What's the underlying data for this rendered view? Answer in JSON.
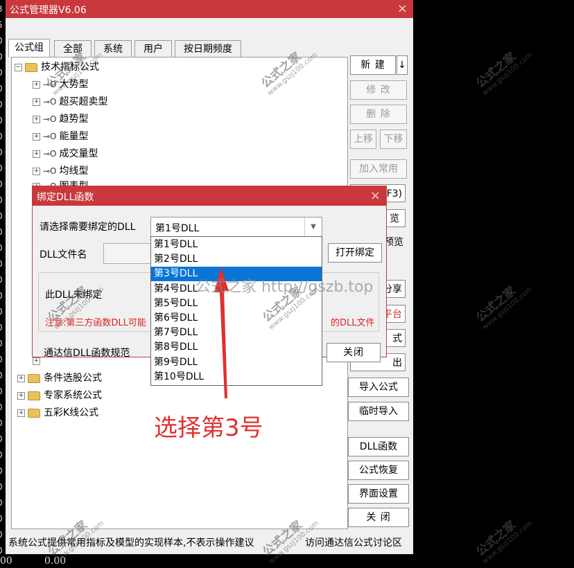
{
  "strip_numbers": [
    "3",
    "5",
    "0",
    "0",
    "0",
    "0",
    "0",
    "0",
    "0",
    "0",
    "0",
    "0",
    "0",
    "0",
    "0",
    "0",
    "0",
    "0",
    "0",
    "0",
    "0",
    "0",
    "0",
    "0",
    "0",
    "0",
    "0",
    "0",
    "0",
    "0",
    "0",
    "0",
    "0",
    "0",
    "0"
  ],
  "bottom_numbers": [
    "00",
    "0.00"
  ],
  "window": {
    "title": "公式管理器V6.06",
    "close": "×",
    "tabs": [
      "公式组",
      "全部",
      "系统",
      "用户",
      "按日期频度"
    ],
    "tree": {
      "root": "技术指标公式",
      "children": [
        "大势型",
        "超买超卖型",
        "趋势型",
        "能量型",
        "成交量型",
        "均线型",
        "图表型"
      ],
      "others": [
        "条件选股公式",
        "专家系统公式",
        "五彩K线公式"
      ]
    },
    "buttons": {
      "new": "新 建",
      "new_arrow": "↓",
      "modify": "修 改",
      "delete": "删 除",
      "up": "上移",
      "down": "下移",
      "add_common": "加入常用",
      "f3": "F3)",
      "browse": "览",
      "preview": "预览",
      "share": "分享",
      "platform": "平台",
      "formula": "式",
      "export": "出",
      "import": "导入公式",
      "temp_import": "临时导入",
      "dll": "DLL函数",
      "restore": "公式恢复",
      "ui_settings": "界面设置",
      "close": "关 闭"
    },
    "status_left": "系统公式提供常用指标及模型的实现样本,不表示操作建议",
    "status_right": "访问通达信公式讨论区"
  },
  "dialog": {
    "title": "绑定DLL函数",
    "close": "×",
    "select_label": "请选择需要绑定的DLL",
    "selected": "第1号DLL",
    "file_label": "DLL文件名",
    "open_bind": "打开绑定",
    "unbound": "此DLL未绑定",
    "warning_left": "注意:第三方函数DLL可能",
    "warning_right": "的DLL文件",
    "spec": "通达信DLL函数规范",
    "close_btn": "关闭",
    "options": [
      "第1号DLL",
      "第2号DLL",
      "第3号DLL",
      "第4号DLL",
      "第5号DLL",
      "第6号DLL",
      "第7号DLL",
      "第8号DLL",
      "第9号DLL",
      "第10号DLL"
    ],
    "highlighted_index": 2
  },
  "annotation": {
    "text": "选择第3号",
    "watermark_url": "公式之家 http://gszb.top",
    "color": "#e03030"
  },
  "watermark": {
    "brand": "公式之家",
    "site": "www.gszj100.com"
  }
}
